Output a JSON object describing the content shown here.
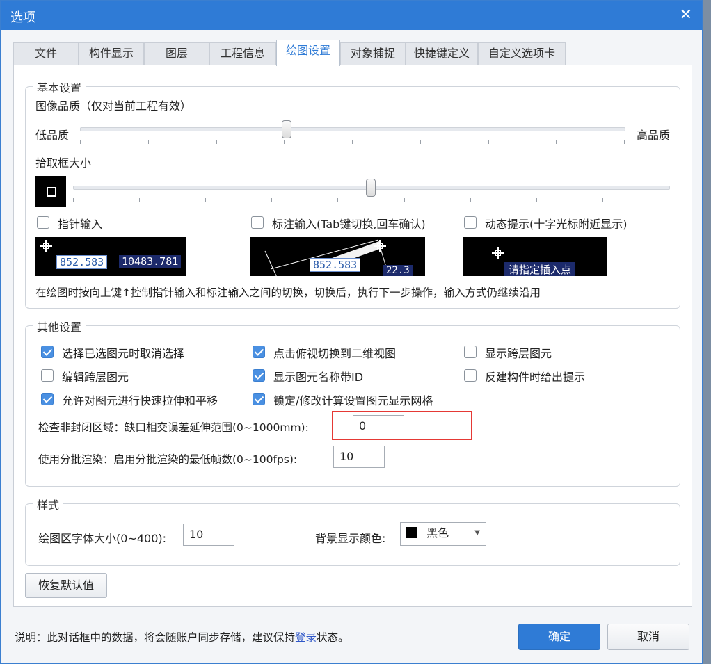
{
  "window": {
    "title": "选项",
    "close_glyph": "✕"
  },
  "tabs": [
    {
      "label": "文件"
    },
    {
      "label": "构件显示"
    },
    {
      "label": "图层"
    },
    {
      "label": "工程信息"
    },
    {
      "label": "绘图设置",
      "active": true
    },
    {
      "label": "对象捕捉"
    },
    {
      "label": "快捷键定义"
    },
    {
      "label": "自定义选项卡"
    }
  ],
  "basic": {
    "title": "基本设置",
    "quality_label": "图像品质（仅对当前工程有效）",
    "low_label": "低品质",
    "high_label": "高品质",
    "quality_level": 0.38,
    "pick_label": "拾取框大小",
    "pick_level": 0.5,
    "pointer_input": {
      "label": "指针输入",
      "checked": false
    },
    "dim_input": {
      "label": "标注输入(Tab键切换,回车确认)",
      "checked": false
    },
    "dynamic_hint": {
      "label": "动态提示(十字光标附近显示)",
      "checked": false
    },
    "preview1": {
      "v1": "852.583",
      "v2": "10483.781"
    },
    "preview2": {
      "v1": "852.583",
      "v2": "22.3"
    },
    "preview3": {
      "hint": "请指定插入点"
    },
    "note": "在绘图时按向上键↑控制指针输入和标注输入之间的切换，切换后，执行下一步操作，输入方式仍继续沿用"
  },
  "other": {
    "title": "其他设置",
    "options": [
      {
        "label": "选择已选图元时取消选择",
        "checked": true
      },
      {
        "label": "点击俯视切换到二维视图",
        "checked": true
      },
      {
        "label": "显示跨层图元",
        "checked": false
      },
      {
        "label": "编辑跨层图元",
        "checked": false
      },
      {
        "label": "显示图元名称带ID",
        "checked": true
      },
      {
        "label": "反建构件时给出提示",
        "checked": false
      },
      {
        "label": "允许对图元进行快速拉伸和平移",
        "checked": true
      },
      {
        "label": "锁定/修改计算设置图元显示网格",
        "checked": true
      }
    ],
    "gap_label": "检查非封闭区域：缺口相交误差延伸范围(0~1000mm):",
    "gap_value": "0",
    "batch_label": "使用分批渲染：启用分批渲染的最低帧数(0~100fps):",
    "batch_value": "10"
  },
  "style": {
    "title": "样式",
    "font_label": "绘图区字体大小(0~400):",
    "font_value": "10",
    "bg_label": "背景显示颜色:",
    "bg_value": "黑色",
    "bg_color": "#000000"
  },
  "restore_label": "恢复默认值",
  "footer": {
    "note_prefix": "说明：此对话框中的数据，将会随账户同步存储，建议保持",
    "login_link": "登录",
    "note_suffix": "状态。",
    "ok_label": "确定",
    "cancel_label": "取消"
  },
  "colors": {
    "accent": "#2f7bd6",
    "highlight_box": "#e53935"
  }
}
